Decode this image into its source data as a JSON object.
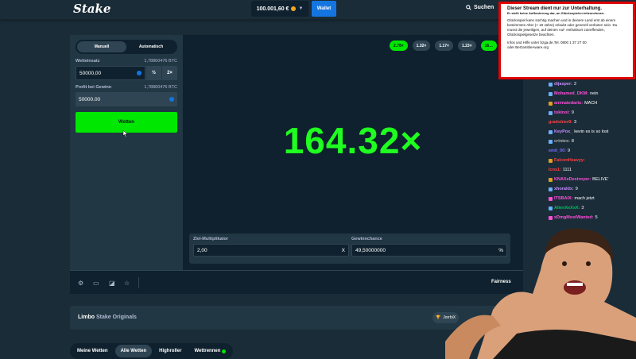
{
  "topbar": {
    "logo": "Stake",
    "balance": "100.001,60 €",
    "wallet_label": "Wallet",
    "search_label": "Suchen"
  },
  "left_panel": {
    "tabs": [
      {
        "label": "Manuell",
        "active": true
      },
      {
        "label": "Automatisch",
        "active": false
      }
    ],
    "bet_label": "Wetteinsatz",
    "bet_btc": "1,78860476 BTC",
    "bet_value": "50000,00",
    "half_label": "½",
    "double_label": "2×",
    "profit_label": "Profit bei Gewinn",
    "profit_btc": "1,78860476 BTC",
    "profit_value": "50000.00",
    "bet_button": "Wetten"
  },
  "game": {
    "history": [
      {
        "label": "2.78×",
        "win": true
      },
      {
        "label": "1.32×",
        "win": false
      },
      {
        "label": "1.17×",
        "win": false
      },
      {
        "label": "1.23×",
        "win": false
      },
      {
        "label": "16…",
        "win": true
      }
    ],
    "multiplier": "164.32×",
    "target_label": "Ziel-Multiplikator",
    "target_value": "2,00",
    "target_suffix": "X",
    "chance_label": "Gewinnchance",
    "chance_value": "49,50000000",
    "chance_suffix": "%"
  },
  "footer": {
    "fairness": "Fairness"
  },
  "info": {
    "game_name": "Limbo",
    "provider": "Stake Originals",
    "badge_text": "JorrbiX"
  },
  "bottom_tabs": [
    {
      "label": "Meine Wetten",
      "active": false
    },
    {
      "label": "Alle Wetten",
      "active": true
    },
    {
      "label": "Highroller",
      "active": false
    },
    {
      "label": "Wettrennen",
      "active": false
    }
  ],
  "page_size": "40",
  "notice": {
    "title": "Dieser Stream dient nur zur Unterhaltung.",
    "subtitle": "Er stellt keine Aufforderung dar, an Glücksspielen teilzunehmen.",
    "body": "Glücksspiel kann süchtig machen und in deinem Land erst ab einem bestimmten Alter (> 18 Jahre) erlaubt oder generell verboten sein. Du musst die jeweiligen, auf deinen Auf- enthaltsort zutreffenden, Glücksspielgesetze beachten.",
    "footer_line1": "Infos und Hilfe unter bzga.de,Tel. 0800 1 37 27 00",
    "footer_line2": "oder BeGambleAware.org"
  },
  "chat": [
    {
      "user": "dijasper:",
      "msg": "2",
      "color": "#c88bff",
      "icon": "#6ab0ff"
    },
    {
      "user": "Mohamed_DKM:",
      "msg": "nein",
      "color": "#ff4fd8",
      "icon": "#6ab0ff"
    },
    {
      "user": "animatedarts:",
      "msg": "MACH",
      "color": "#ff4fd8",
      "icon": "#e0a020"
    },
    {
      "user": "tokinol:",
      "msg": "9",
      "color": "#ff4fd8",
      "icon": "#6ab0ff"
    },
    {
      "user": "gratisbier8:",
      "msg": "3",
      "color": "#ff4040",
      "icon": ""
    },
    {
      "user": "KeyPox_",
      "msg": "kevin es is so lost",
      "color": "#c88bff",
      "icon": "#6ab0ff"
    },
    {
      "user": "crintex:",
      "msg": "8",
      "color": "#b0b0b0",
      "icon": "#6ab0ff"
    },
    {
      "user": "emil_00:",
      "msg": "9",
      "color": "#7a6bff",
      "icon": ""
    },
    {
      "user": "FalconHeavyy:",
      "msg": "",
      "color": "#ff4040",
      "icon": "#e0a020"
    },
    {
      "user": "lcns1:",
      "msg": "1111",
      "color": "#ff4040",
      "icon": ""
    },
    {
      "user": "KNAXeDestroyer:",
      "msg": "BELIVE'",
      "color": "#ff4fd8",
      "icon": "#e0a020"
    },
    {
      "user": "xhoraldx:",
      "msg": "9",
      "color": "#c88bff",
      "icon": "#6ab0ff"
    },
    {
      "user": "ITSBAIX:",
      "msg": "mach jetzt",
      "color": "#ff4fd8",
      "icon": "#ff4fd8"
    },
    {
      "user": "AlienXxXxX:",
      "msg": "3",
      "color": "#00c060",
      "icon": "#6ab0ff"
    },
    {
      "user": "xDmgMostWanted:",
      "msg": "5",
      "color": "#ff4fd8",
      "icon": "#ff4fd8"
    }
  ],
  "colors": {
    "bg": "#1a2c38",
    "panel": "#213743",
    "dark": "#0f212e",
    "accent_green": "#00e701",
    "multiplier_green": "#1fff20",
    "wallet_blue": "#1475e1",
    "notice_border": "#e00000"
  }
}
